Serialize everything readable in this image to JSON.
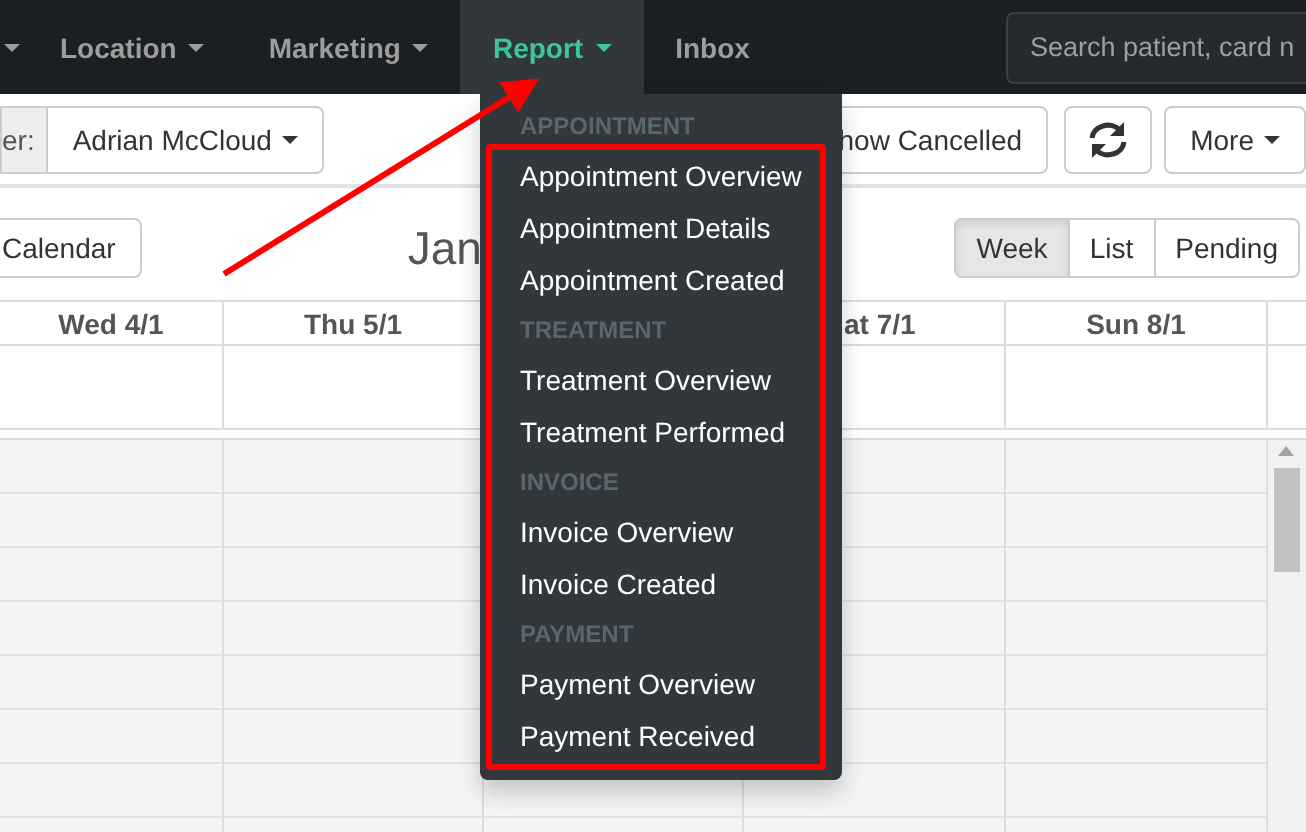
{
  "navbar": {
    "items": [
      {
        "label": "Location",
        "dropdown": true,
        "selected": false
      },
      {
        "label": "Marketing",
        "dropdown": true,
        "selected": false
      },
      {
        "label": "Report",
        "dropdown": true,
        "selected": true
      },
      {
        "label": "Inbox",
        "dropdown": false,
        "selected": false
      }
    ],
    "search": {
      "placeholder": "Search patient, card n"
    }
  },
  "toolbar": {
    "filter_label": "er:",
    "practitioner": "Adrian McCloud",
    "show_cancelled": "how Cancelled",
    "more": "More"
  },
  "calendar": {
    "today_button": "Calendar",
    "title": "Jan",
    "views": [
      {
        "label": "Week",
        "selected": true
      },
      {
        "label": "List",
        "selected": false
      },
      {
        "label": "Pending",
        "selected": false
      }
    ],
    "days": [
      "Wed 4/1",
      "Thu 5/1",
      "at 7/1",
      "Sun 8/1"
    ]
  },
  "report_menu": [
    {
      "kind": "header",
      "label": "APPOINTMENT"
    },
    {
      "kind": "item",
      "label": "Appointment Overview"
    },
    {
      "kind": "item",
      "label": "Appointment Details"
    },
    {
      "kind": "item",
      "label": "Appointment Created"
    },
    {
      "kind": "header",
      "label": "TREATMENT"
    },
    {
      "kind": "item",
      "label": "Treatment Overview"
    },
    {
      "kind": "item",
      "label": "Treatment Performed"
    },
    {
      "kind": "header",
      "label": "INVOICE"
    },
    {
      "kind": "item",
      "label": "Invoice Overview"
    },
    {
      "kind": "item",
      "label": "Invoice Created"
    },
    {
      "kind": "header",
      "label": "PAYMENT"
    },
    {
      "kind": "item",
      "label": "Payment Overview"
    },
    {
      "kind": "item",
      "label": "Payment Received"
    }
  ]
}
